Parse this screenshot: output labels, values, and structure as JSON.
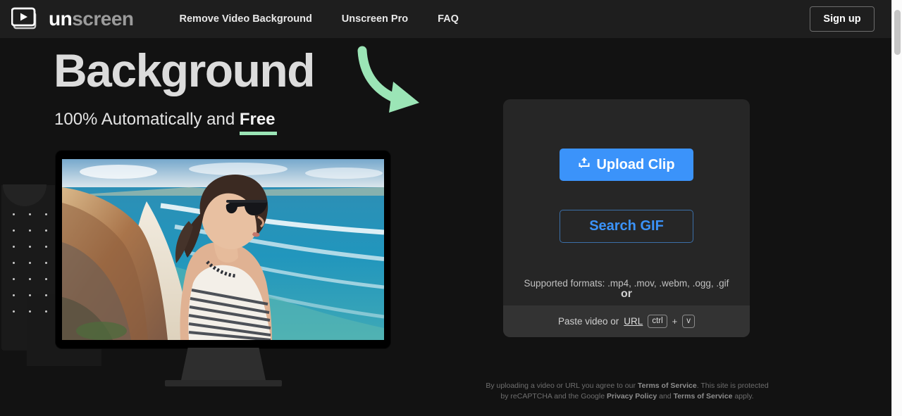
{
  "header": {
    "logo": {
      "part1": "un",
      "part2": "screen",
      "icon": "video-play-stack-icon"
    },
    "nav": [
      {
        "label": "Remove Video Background"
      },
      {
        "label": "Unscreen Pro"
      },
      {
        "label": "FAQ"
      }
    ],
    "signup_label": "Sign up"
  },
  "hero": {
    "title": "Background",
    "subtitle_prefix": "100% Automatically and ",
    "subtitle_highlight": "Free",
    "arrow_color": "#9be5b6"
  },
  "preview": {
    "description": "Woman in striped top on a coastal cliff overlooking the ocean"
  },
  "panel": {
    "upload_label": "Upload Clip",
    "upload_icon": "upload-icon",
    "or_label": "or",
    "search_gif_label": "Search GIF",
    "formats_text": "Supported formats: .mp4, .mov, .webm, .ogg, .gif",
    "paste": {
      "text_before": "Paste video or ",
      "url_label": "URL",
      "key_ctrl": "ctrl",
      "plus": "+",
      "key_v": "v"
    },
    "accent_color": "#3b93fa"
  },
  "legal": {
    "line1_a": "By uploading a video or URL you agree to our ",
    "line1_b": "Terms of Service",
    "line1_c": ". This site is protected",
    "line2_a": "by reCAPTCHA and the Google ",
    "line2_b": "Privacy Policy",
    "line2_c": " and ",
    "line2_d": "Terms of Service",
    "line2_e": " apply."
  }
}
